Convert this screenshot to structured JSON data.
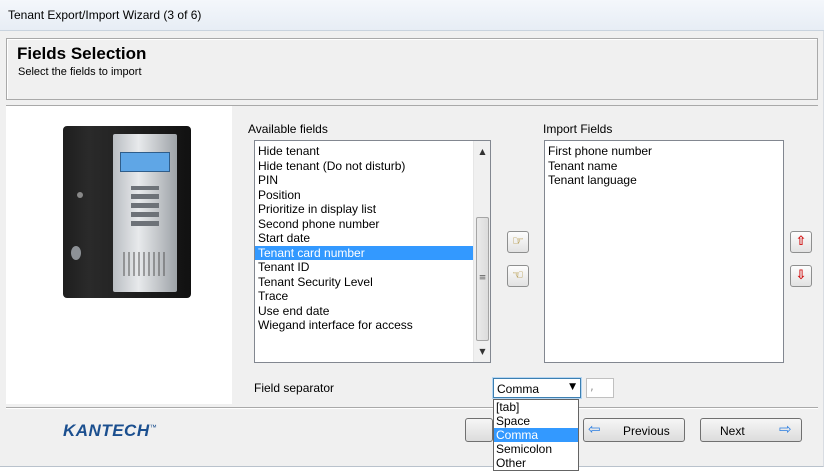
{
  "window": {
    "title": "Tenant Export/Import Wizard (3 of 6)"
  },
  "header": {
    "title": "Fields Selection",
    "subtitle": "Select the fields to import"
  },
  "available": {
    "label": "Available fields",
    "items": [
      "Hide tenant",
      "Hide tenant (Do not disturb)",
      "PIN",
      "Position",
      "Prioritize in display list",
      "Second phone number",
      "Start date",
      "Tenant card number",
      "Tenant ID",
      "Tenant Security Level",
      "Trace",
      "Use end date",
      "Wiegand interface for access"
    ],
    "selected_index": 7
  },
  "import": {
    "label": "Import Fields",
    "items": [
      "First phone number",
      "Tenant name",
      "Tenant language"
    ]
  },
  "separator": {
    "label": "Field separator",
    "value": "Comma",
    "char": ",",
    "options": [
      "[tab]",
      "Space",
      "Comma",
      "Semicolon",
      "Other"
    ],
    "selected_option": "Comma"
  },
  "footer": {
    "logo": "KANTECH",
    "previous_label": "Previous",
    "next_label": "Next"
  },
  "colors": {
    "selection": "#3399ff",
    "logo": "#1b4f8f"
  },
  "icons": [
    "hand-right-icon",
    "hand-left-icon",
    "arrow-up-icon",
    "arrow-down-icon",
    "arrow-left-icon",
    "arrow-right-icon"
  ]
}
